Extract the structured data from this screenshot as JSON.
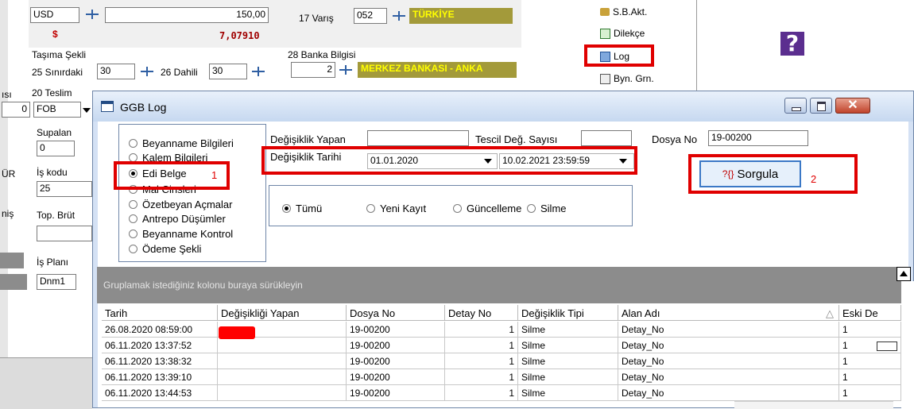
{
  "bg": {
    "currency": "USD",
    "currency_symbol": "$",
    "amount": "150,00",
    "rate": "7,07910",
    "varis_label": "17 Varış",
    "varis_code": "052",
    "varis_name": "TÜRKİYE",
    "tasima_label": "Taşıma Şekli",
    "sinirdaki_label": "25 Sınırdaki",
    "sinirdaki_value": "30",
    "dahili_label": "26 Dahili",
    "dahili_value": "30",
    "banka_label": "28 Banka Bilgisi",
    "banka_value": "2",
    "banka_name": "MERKEZ BANKASI - ANKA",
    "sayisi_label": "ısı",
    "teslim_label": "20 Teslim",
    "zero_value": "0",
    "fob_value": "FOB",
    "supalan_label": "Supalan",
    "supalan_value": "0",
    "ur_label": "ÜR",
    "is_kodu_label": "İş kodu",
    "is_kodu_value": "25",
    "nis_label": "niş",
    "top_brut_label": "Top. Brüt",
    "is_plani_label": "İş Planı",
    "dnm_value": "Dnm1",
    "side_buttons": [
      "S.B.Akt.",
      "Dilekçe",
      "Log",
      "Byn. Grn."
    ]
  },
  "dialog": {
    "title": "GGB Log",
    "options": [
      {
        "label": "Beyanname Bilgileri",
        "selected": false
      },
      {
        "label": "Kalem Bilgileri",
        "selected": false
      },
      {
        "label": "Edi Belge",
        "selected": true
      },
      {
        "label": "Mal Cinsleri",
        "selected": false
      },
      {
        "label": "Özetbeyan Açmalar",
        "selected": false
      },
      {
        "label": "Antrepo Düşümler",
        "selected": false
      },
      {
        "label": "Beyanname Kontrol",
        "selected": false
      },
      {
        "label": "Ödeme Şekli",
        "selected": false
      }
    ],
    "degisiklik_yapan_label": "Değişiklik Yapan",
    "tescil_label": "Tescil Değ. Sayısı",
    "dosya_no_label": "Dosya No",
    "dosya_no_value": "19-00200",
    "degisiklik_tarihi_label": "Değişiklik Tarihi",
    "date_from": "01.01.2020",
    "date_to": "10.02.2021 23:59:59",
    "sorgula_label": "Sorgula",
    "sorgula_icon": "?{}",
    "filters": [
      {
        "label": "Tümü",
        "selected": true
      },
      {
        "label": "Yeni Kayıt",
        "selected": false
      },
      {
        "label": "Güncelleme",
        "selected": false
      },
      {
        "label": "Silme",
        "selected": false
      }
    ],
    "group_hint": "Gruplamak istediğiniz kolonu buraya sürükleyin",
    "columns": [
      "Tarih",
      "Değişikliği Yapan",
      "Dosya No",
      "Detay No",
      "Değişiklik Tipi",
      "Alan Adı",
      "Eski De"
    ],
    "sort_indicator": "△",
    "rows": [
      {
        "tarih": "26.08.2020 08:59:00",
        "dosya": "19-00200",
        "detay": "1",
        "tip": "Silme",
        "alan": "Detay_No",
        "eski": "1"
      },
      {
        "tarih": "06.11.2020 13:37:52",
        "dosya": "19-00200",
        "detay": "1",
        "tip": "Silme",
        "alan": "Detay_No",
        "eski": "1"
      },
      {
        "tarih": "06.11.2020 13:38:32",
        "dosya": "19-00200",
        "detay": "1",
        "tip": "Silme",
        "alan": "Detay_No",
        "eski": "1"
      },
      {
        "tarih": "06.11.2020 13:39:10",
        "dosya": "19-00200",
        "detay": "1",
        "tip": "Silme",
        "alan": "Detay_No",
        "eski": "1"
      },
      {
        "tarih": "06.11.2020 13:44:53",
        "dosya": "19-00200",
        "detay": "1",
        "tip": "Silme",
        "alan": "Detay_No",
        "eski": "1"
      }
    ]
  },
  "annotations": {
    "n1": "1",
    "n2": "2"
  },
  "colors": {
    "highlight": "#e00000",
    "mustard": "#a39a3a",
    "mustard_text": "#ffff00"
  }
}
